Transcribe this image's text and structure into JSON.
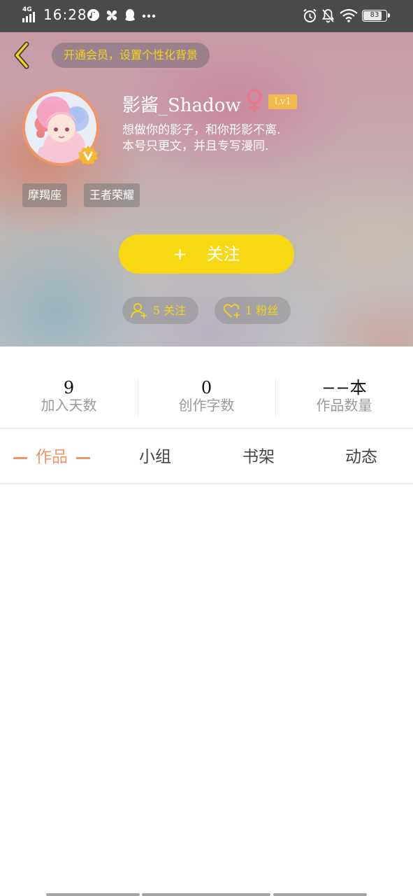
{
  "status_bar": {
    "network": "4G",
    "time": "16:28",
    "battery": "83",
    "battery_level": 0.83
  },
  "header": {
    "vip_prompt": "开通会员，设置个性化背景",
    "username": "影酱_Shadow",
    "level": "Lv1",
    "bio": "想做你的影子，和你形影不离.\n本号只更文，并且专写漫同.",
    "tags": [
      "摩羯座",
      "王者荣耀"
    ],
    "follow_button": {
      "plus": "+",
      "label": "关注"
    },
    "following": "5 关注",
    "fans": "1 粉丝"
  },
  "stats": [
    {
      "value": "9",
      "label": "加入天数"
    },
    {
      "value": "0",
      "label": "创作字数"
    },
    {
      "value": "−−本",
      "label": "作品数量"
    }
  ],
  "tabs": [
    {
      "label": "作品",
      "active": true
    },
    {
      "label": "小组",
      "active": false
    },
    {
      "label": "书架",
      "active": false
    },
    {
      "label": "动态",
      "active": false
    }
  ],
  "colors": {
    "accent": "#f0946a",
    "follow_yellow": "#f8d813",
    "pill_text": "#f5d21a",
    "level_badge": "#f2b94b",
    "gender": "#e8788c"
  }
}
